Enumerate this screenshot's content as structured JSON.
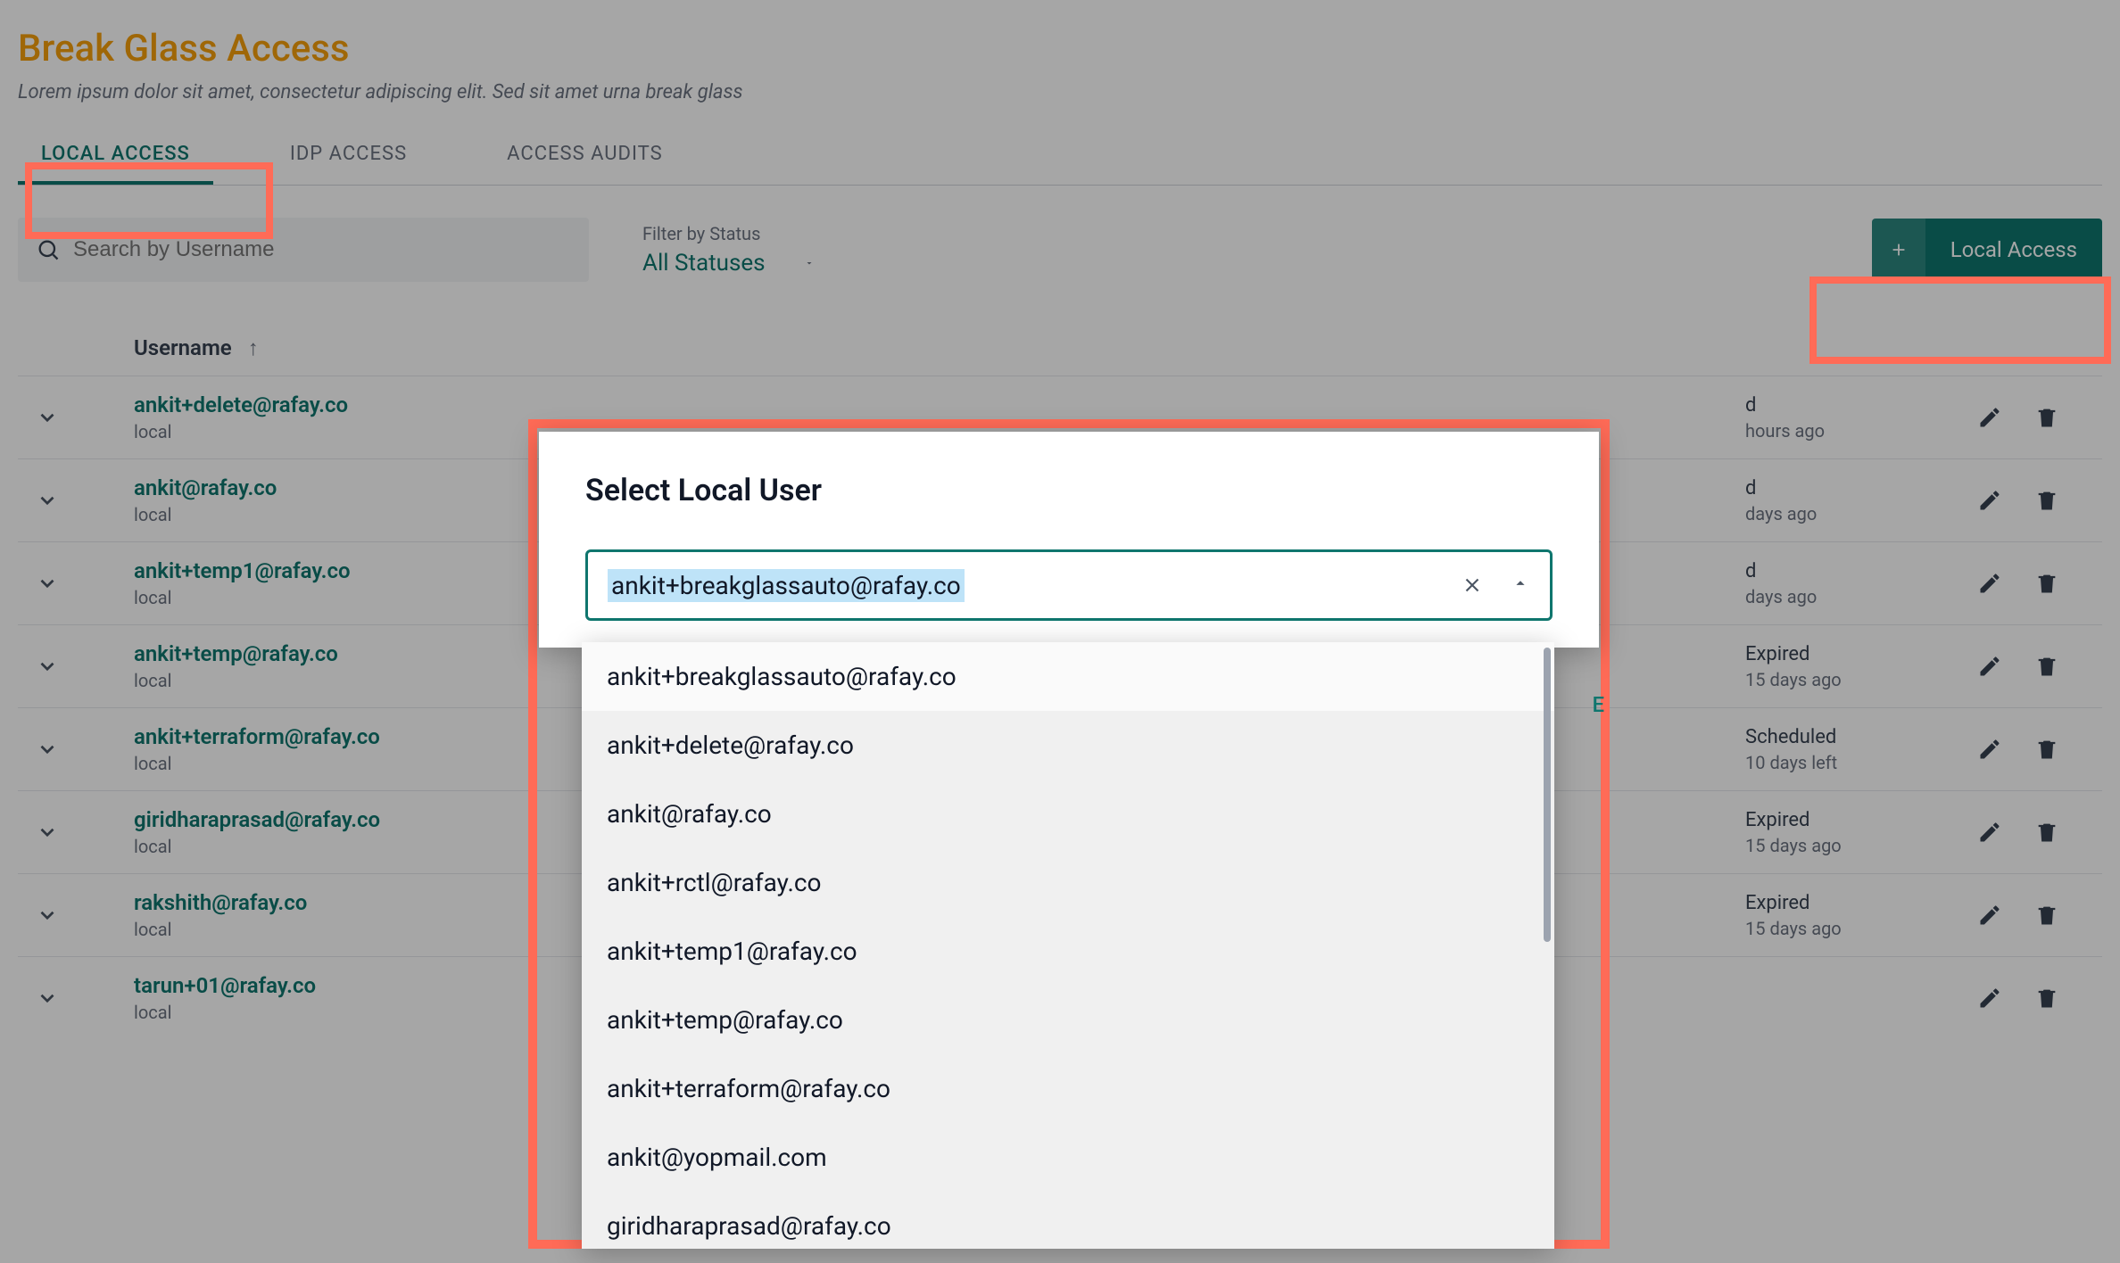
{
  "page": {
    "title": "Break Glass Access",
    "subtitle": "Lorem ipsum dolor sit amet, consectetur adipiscing elit. Sed sit amet urna break glass"
  },
  "tabs": {
    "local": "LOCAL ACCESS",
    "idp": "IDP ACCESS",
    "audits": "ACCESS AUDITS"
  },
  "search": {
    "placeholder": "Search by Username"
  },
  "filter": {
    "label": "Filter by Status",
    "value": "All Statuses"
  },
  "add_button": {
    "label": "Local Access"
  },
  "table": {
    "header": {
      "username": "Username"
    },
    "rows": [
      {
        "username": "ankit+delete@rafay.co",
        "type": "local",
        "status": "d",
        "status_sub": "hours ago"
      },
      {
        "username": "ankit@rafay.co",
        "type": "local",
        "status": "d",
        "status_sub": "days ago"
      },
      {
        "username": "ankit+temp1@rafay.co",
        "type": "local",
        "status": "d",
        "status_sub": "days ago"
      },
      {
        "username": "ankit+temp@rafay.co",
        "type": "local",
        "status": "Expired",
        "status_sub": "15 days ago"
      },
      {
        "username": "ankit+terraform@rafay.co",
        "type": "local",
        "status": "Scheduled",
        "status_sub": "10 days left"
      },
      {
        "username": "giridharaprasad@rafay.co",
        "type": "local",
        "status": "Expired",
        "status_sub": "15 days ago"
      },
      {
        "username": "rakshith@rafay.co",
        "type": "local",
        "status": "Expired",
        "status_sub": "15 days ago"
      },
      {
        "username": "tarun+01@rafay.co",
        "type": "local",
        "status": "",
        "status_sub": ""
      }
    ]
  },
  "dialog": {
    "title": "Select Local User",
    "selected": "ankit+breakglassauto@rafay.co",
    "continue_hint_fragment": "E",
    "options": [
      "ankit+breakglassauto@rafay.co",
      "ankit+delete@rafay.co",
      "ankit@rafay.co",
      "ankit+rctl@rafay.co",
      "ankit+temp1@rafay.co",
      "ankit+temp@rafay.co",
      "ankit+terraform@rafay.co",
      "ankit@yopmail.com",
      "giridharaprasad@rafay.co"
    ]
  },
  "colors": {
    "accent": "#0F766E",
    "highlight": "#FF6B57",
    "title": "#F59E0B"
  }
}
